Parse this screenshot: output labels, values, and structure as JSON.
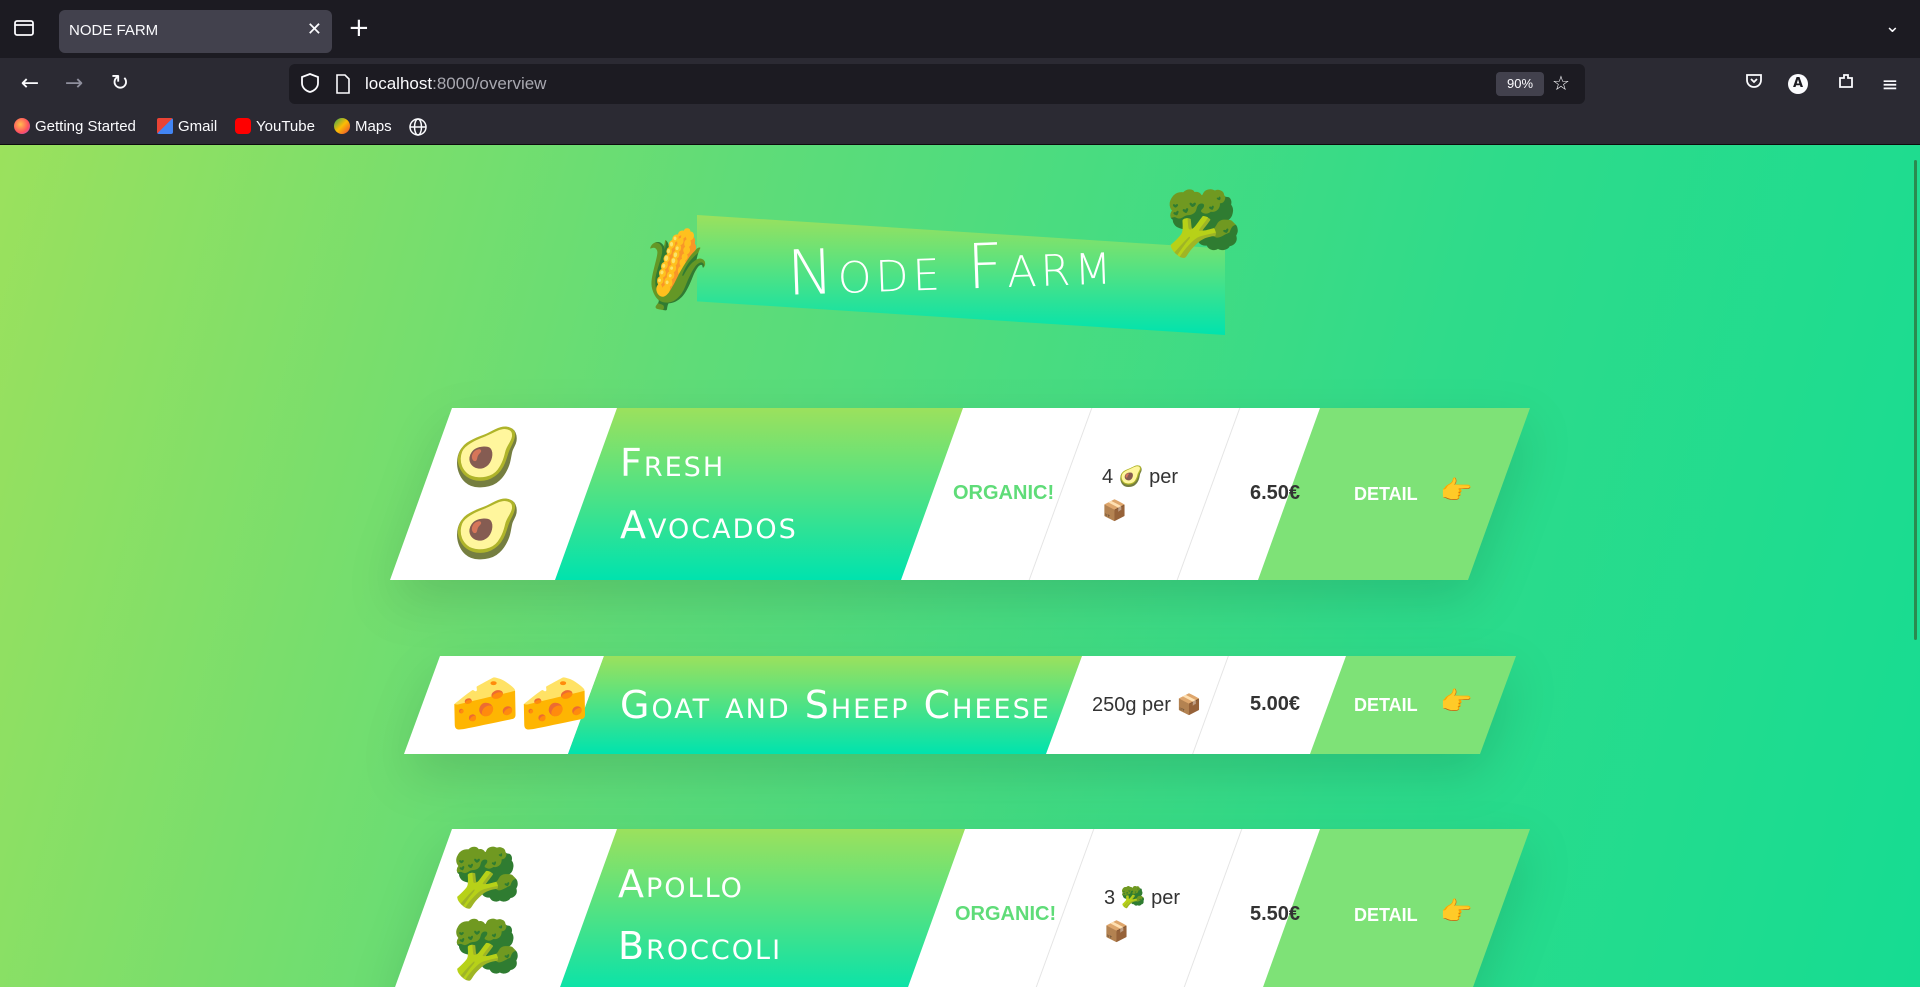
{
  "browser": {
    "tab_title": "NODE FARM",
    "url_host": "localhost",
    "url_rest": ":8000/overview",
    "zoom": "90%",
    "bookmarks": [
      "Getting Started",
      "Gmail",
      "YouTube",
      "Maps"
    ]
  },
  "page": {
    "heading": "Node Farm",
    "heading_emojis": [
      "🌽",
      "🥦"
    ],
    "products": [
      {
        "emoji": "🥑",
        "name_line1": "Fresh",
        "name_line2": "Avocados",
        "organic": "ORGANIC!",
        "qty": "4 🥑 per",
        "qty2": "📦",
        "price": "6.50€",
        "detail": "DETAIL",
        "hand": "👉"
      },
      {
        "emoji": "🧀",
        "name_line1": "Goat and Sheep Cheese",
        "name_line2": "",
        "organic": "",
        "qty": "250g per 📦",
        "qty2": "",
        "price": "5.00€",
        "detail": "DETAIL",
        "hand": "👉"
      },
      {
        "emoji": "🥦",
        "name_line1": "Apollo",
        "name_line2": "Broccoli",
        "organic": "ORGANIC!",
        "qty": "3 🥦 per",
        "qty2": "📦",
        "price": "5.50€",
        "detail": "DETAIL",
        "hand": "👉"
      }
    ]
  }
}
